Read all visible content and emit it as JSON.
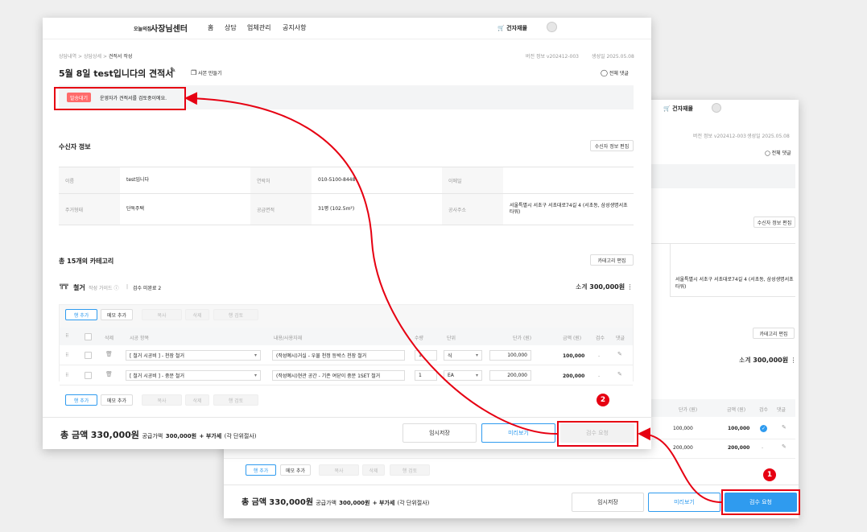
{
  "back": {
    "material_shop": "건자재몰",
    "version": "버전 정보 v202412-003",
    "created": "생성일 2025.05.08",
    "all_comments": "전체 댓글",
    "edit_recipient": "수신자 정보 편집",
    "address": "서울특별시 서초구 서초대로74길 4 (서초동, 삼성생명서초타워)",
    "edit_category": "카테고리 편집",
    "subtotal_label": "소계",
    "subtotal": "300,000원",
    "col_unit_price": "단가 (원)",
    "col_amount": "금액 (원)",
    "col_inspect": "검수",
    "col_comment": "댓글",
    "rows": [
      {
        "unit_price": "100,000",
        "amount": "100,000",
        "inspect": "check"
      },
      {
        "unit_price": "200,000",
        "amount": "200,000",
        "inspect": "-"
      }
    ],
    "add_row": "행 추가",
    "add_memo": "메모 추가",
    "copy": "복사",
    "delete": "삭제",
    "row_inspect": "행 검토",
    "total_label": "총 금액",
    "total": "330,000원",
    "total_sub": "공급가액",
    "supply": "300,000원",
    "vat": "+ 부가세",
    "vat_note": "(각 단위절사)",
    "temp_save": "임시저장",
    "preview": "미리보기",
    "request": "검수 요청",
    "badge": "1"
  },
  "front": {
    "logo_small": "오늘의집",
    "logo": "사장님센터",
    "nav": [
      "홈",
      "상담",
      "업체관리",
      "공지사항"
    ],
    "material_shop": "건자재몰",
    "breadcrumb": [
      "상담내역",
      "상담상세",
      "견적서 작성"
    ],
    "version": "버전 정보 v202412-003",
    "created": "생성일 2025.05.08",
    "title": "5월 8일 test입니다의 견적서",
    "copy_doc": "사본 만들기",
    "all_comments": "전체 댓글",
    "status_badge": "발송대기",
    "status_msg": "운영자가 견적서를 검토중이에요.",
    "recipient_title": "수신자 정보",
    "edit_recipient": "수신자 정보 편집",
    "info": {
      "name_l": "이름",
      "name": "test입니다",
      "phone_l": "연락처",
      "phone": "010-5100-8448",
      "email_l": "이메일",
      "email": "",
      "house_l": "주거형태",
      "house": "단독주택",
      "area_l": "공급면적",
      "area": "31평 (102.5m²)",
      "addr_l": "공사주소",
      "addr": "서울특별시 서초구 서초대로74길 4 (서초동, 삼성생명서초타워)"
    },
    "category_count": "총 15개의 카테고리",
    "edit_category": "카테고리 편집",
    "cat_name": "철거",
    "guide": "작성 가이드",
    "inspect_pending": "검수 미완료 2",
    "subtotal_label": "소계",
    "subtotal": "300,000원",
    "add_row": "행 추가",
    "add_memo": "메모 추가",
    "copy": "복사",
    "delete": "삭제",
    "row_inspect": "행 검토",
    "cols": [
      "삭제",
      "시공 항목",
      "내용/사용자재",
      "수량",
      "단위",
      "단가 (원)",
      "금액 (원)",
      "검수",
      "댓글"
    ],
    "rows": [
      {
        "item": "[ 철거 시공비 ] - 천장 철거",
        "content": "(작성예시)거실 - 우물 천정 등박스 천장 철거",
        "qty": "1",
        "unit": "식",
        "unit_price": "100,000",
        "amount": "100,000",
        "inspect": "-"
      },
      {
        "item": "[ 철거 시공비 ] - 중문 철거",
        "content": "(작성예시)현관 공간 - 기존 여닫이 중문 1SET 철거",
        "qty": "1",
        "unit": "EA",
        "unit_price": "200,000",
        "amount": "200,000",
        "inspect": "-"
      }
    ],
    "total_label": "총 금액",
    "total": "330,000원",
    "total_sub": "공급가액",
    "supply": "300,000원",
    "vat": "+ 부가세",
    "vat_note": "(각 단위절사)",
    "temp_save": "임시저장",
    "preview": "미리보기",
    "request": "검수 요청",
    "badge": "2"
  },
  "colors": {
    "accent": "#2f9bef",
    "highlight": "#e60012",
    "status": "#ff6b6b"
  }
}
